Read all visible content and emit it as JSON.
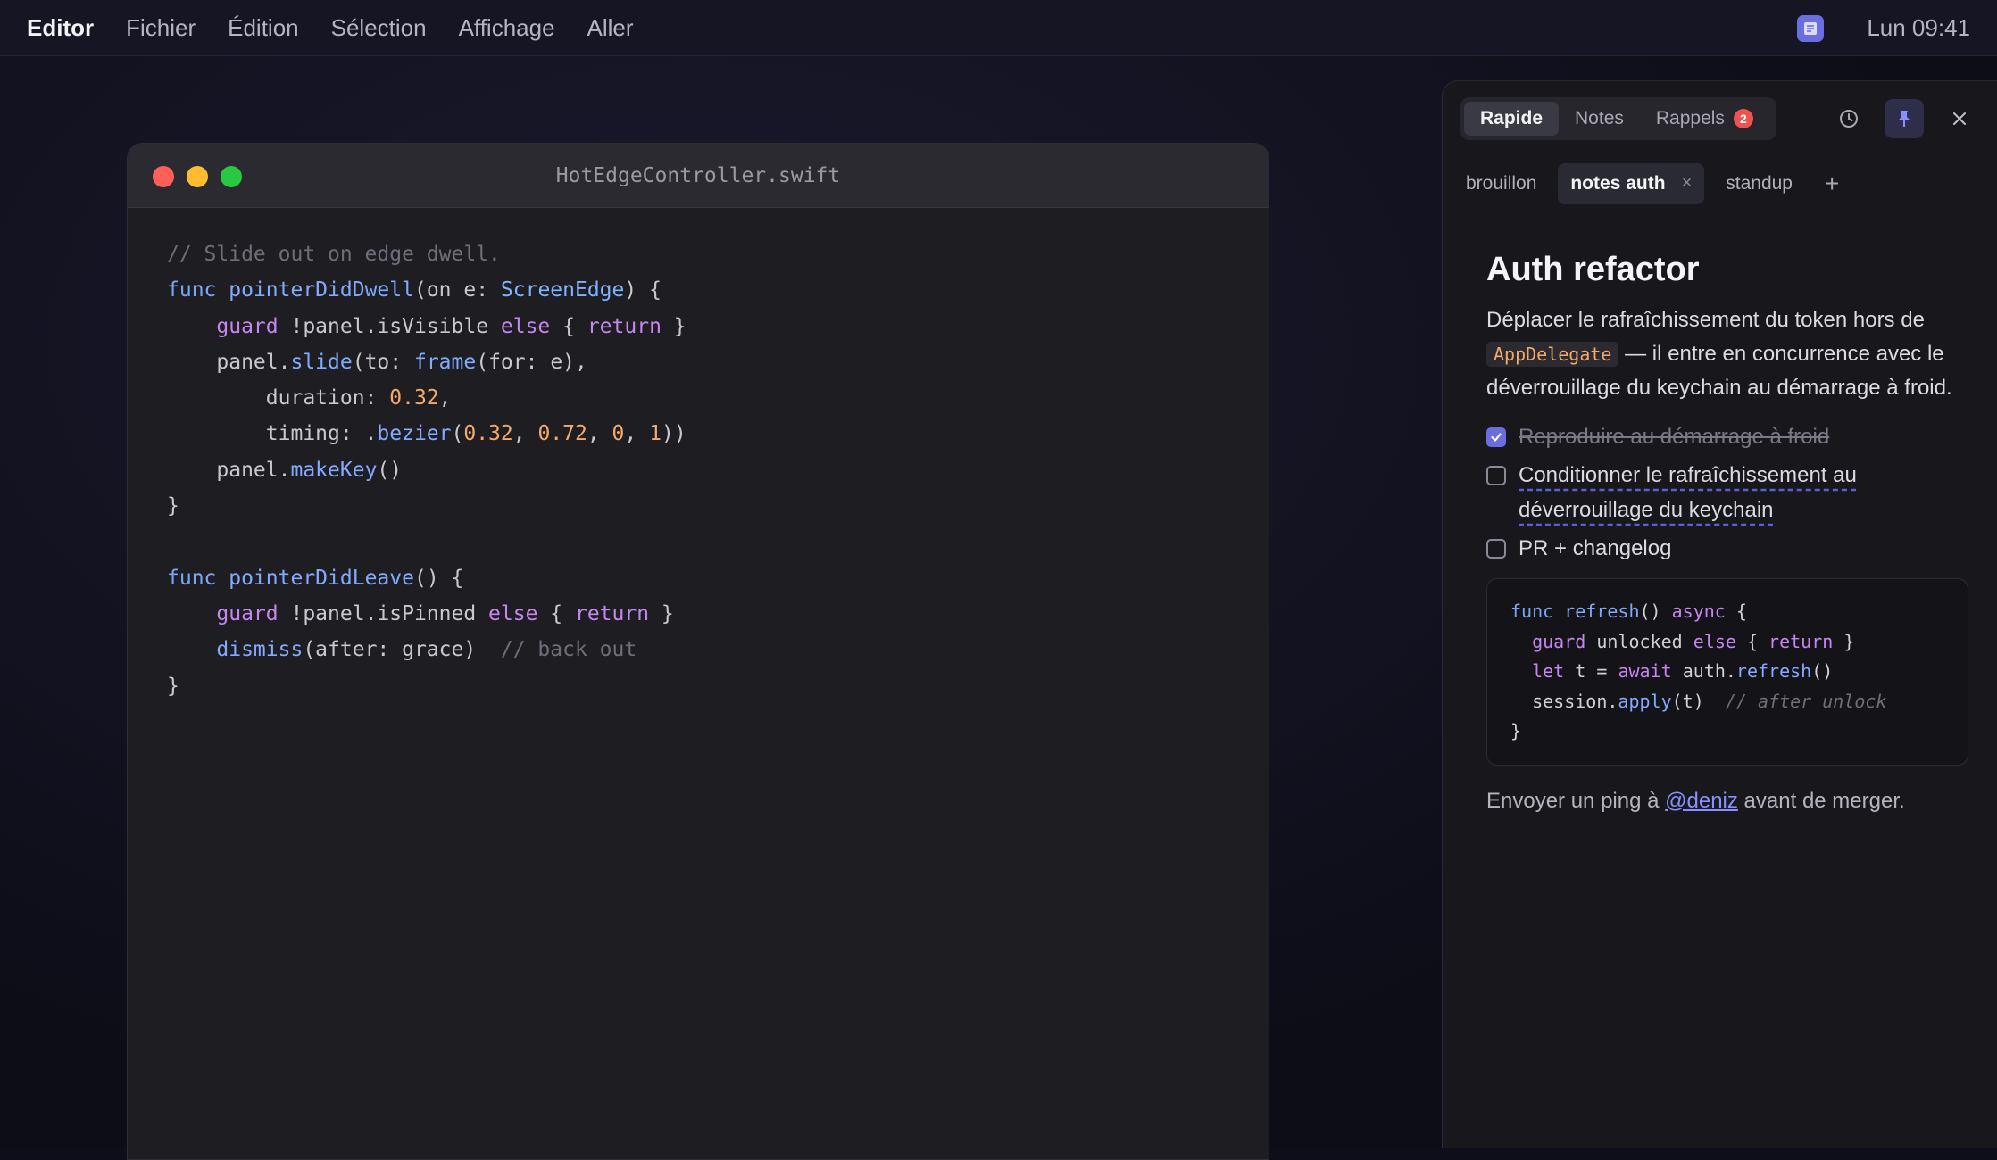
{
  "menubar": {
    "app": "Editor",
    "menus": [
      "Fichier",
      "Édition",
      "Sélection",
      "Affichage",
      "Aller"
    ],
    "clock": "Lun 09:41"
  },
  "editor": {
    "filename": "HotEdgeController.swift",
    "code_lines": [
      "// Slide out on edge dwell.",
      "func pointerDidDwell(on e: ScreenEdge) {",
      "    guard !panel.isVisible else { return }",
      "    panel.slide(to: frame(for: e),",
      "        duration: 0.32,",
      "        timing: .bezier(0.32, 0.72, 0, 1))",
      "    panel.makeKey()",
      "}",
      "",
      "func pointerDidLeave() {",
      "    guard !panel.isPinned else { return }",
      "    dismiss(after: grace)  // back out",
      "}"
    ]
  },
  "panel": {
    "segments": [
      {
        "label": "Rapide",
        "active": true
      },
      {
        "label": "Notes",
        "active": false
      },
      {
        "label": "Rappels",
        "active": false,
        "badge": "2"
      }
    ],
    "tabs": [
      {
        "label": "brouillon",
        "active": false
      },
      {
        "label": "notes auth",
        "active": true,
        "close": "×"
      },
      {
        "label": "standup",
        "active": false
      }
    ],
    "tab_add": "+",
    "note": {
      "title": "Auth refactor",
      "para_part1": "Déplacer le rafraîchissement du token hors de ",
      "para_code": "AppDelegate",
      "para_part2": " — il entre en concurrence avec le déverrouillage du keychain au démarrage à froid.",
      "todos": [
        {
          "text": "Reproduire au démarrage à froid",
          "done": true
        },
        {
          "text": "Conditionner le rafraîchissement au déverrouillage du keychain",
          "done": false
        },
        {
          "text": "PR + changelog",
          "done": false
        }
      ],
      "code_lines": [
        "func refresh() async {",
        "  guard unlocked else { return }",
        "  let t = await auth.refresh()",
        "  session.apply(t)  // after unlock",
        "}"
      ],
      "footer_before": "Envoyer un ping à ",
      "footer_mention": "@deniz",
      "footer_after": " avant de merger."
    }
  },
  "colors": {
    "accent": "#6b6ee0",
    "badge": "#f0534f",
    "keyword": "#c586f0",
    "function": "#82aaff",
    "number": "#f5a96a"
  }
}
